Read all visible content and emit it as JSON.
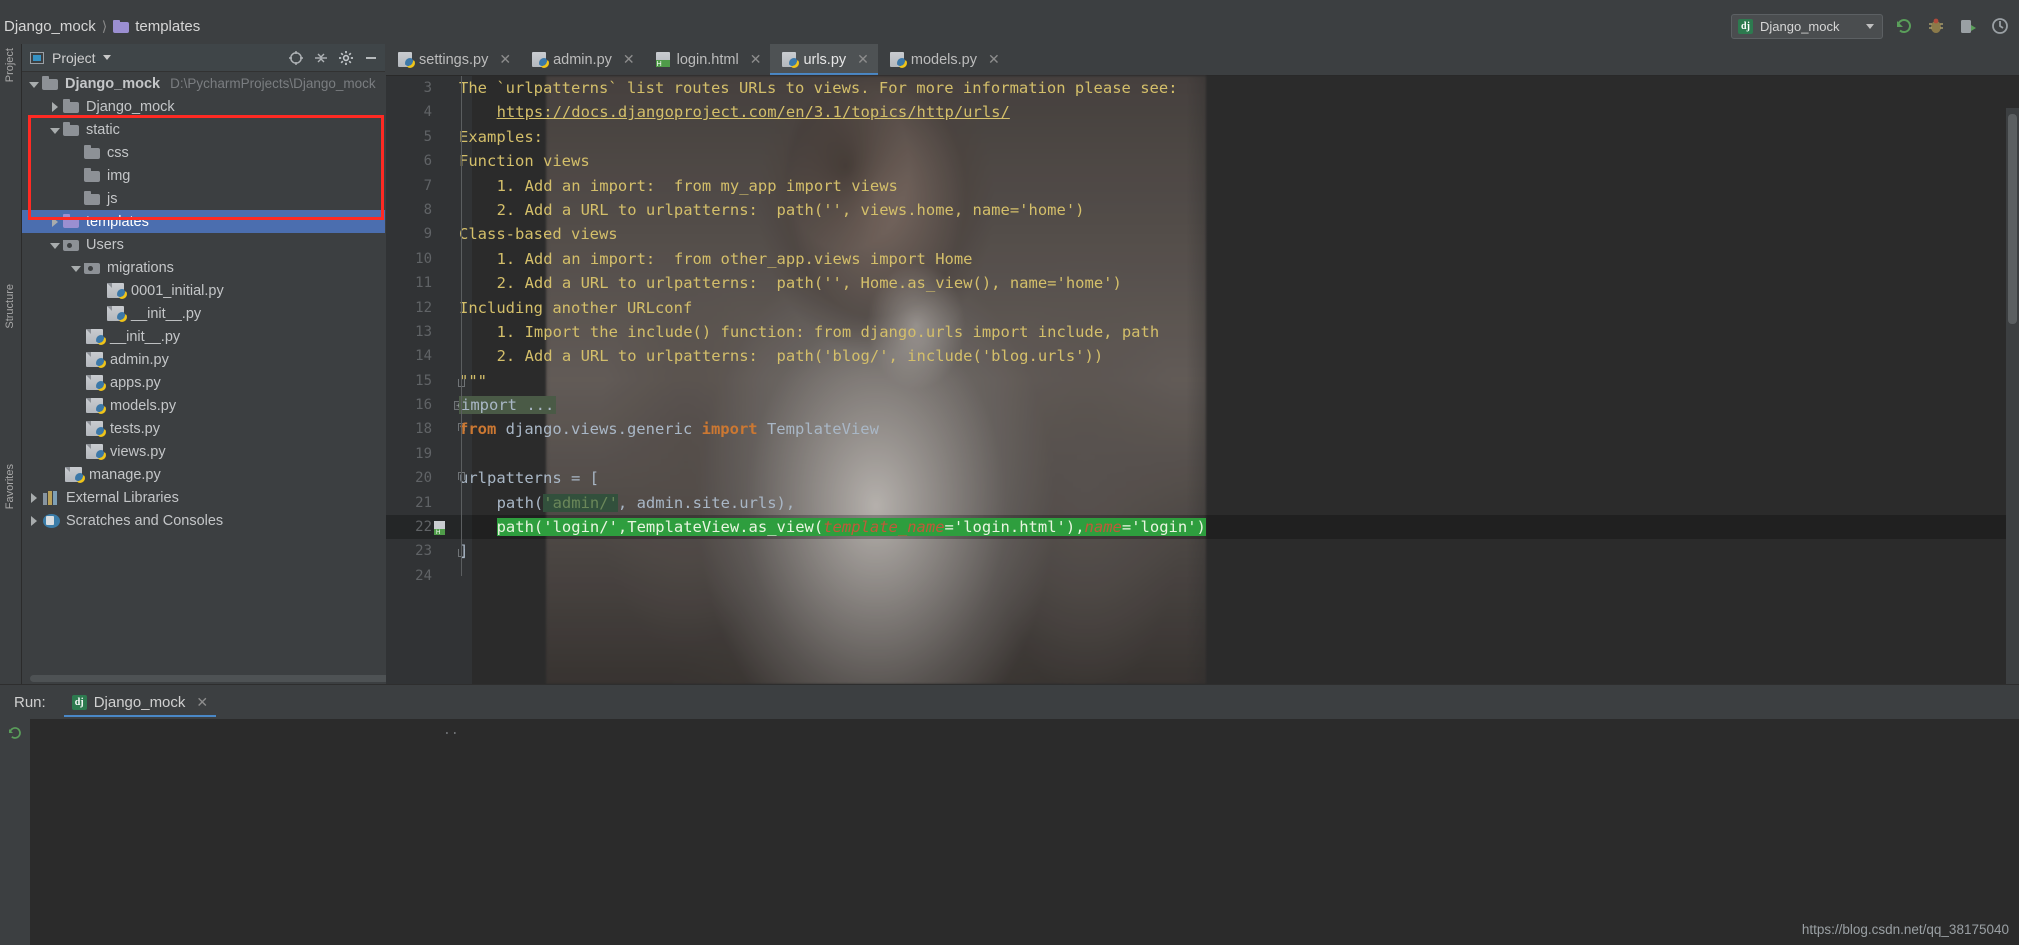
{
  "window": {
    "breadcrumb_project": "Django_mock",
    "breadcrumb_folder": "templates",
    "run_config_name": "Django_mock",
    "run_config_icon": "dj"
  },
  "toolbar_right": {
    "icons": [
      "rerun-icon",
      "debug-icon",
      "coverage-icon",
      "profile-icon"
    ]
  },
  "project_panel": {
    "title": "Project",
    "tools": [
      "locate-icon",
      "collapse-all-icon",
      "settings-gear-icon",
      "hide-icon"
    ],
    "tree": [
      {
        "label": "Django_mock",
        "path": "D:\\PycharmProjects\\Django_mock",
        "icon": "folder",
        "arrow": "down",
        "indent": 0,
        "bold": true,
        "selected": false
      },
      {
        "label": "Django_mock",
        "path": "",
        "icon": "folder",
        "arrow": "right",
        "indent": 1,
        "bold": false,
        "selected": false
      },
      {
        "label": "static",
        "path": "",
        "icon": "folder",
        "arrow": "down",
        "indent": 1,
        "bold": false,
        "selected": false
      },
      {
        "label": "css",
        "path": "",
        "icon": "folder",
        "arrow": "none",
        "indent": 2,
        "bold": false,
        "selected": false
      },
      {
        "label": "img",
        "path": "",
        "icon": "folder",
        "arrow": "none",
        "indent": 2,
        "bold": false,
        "selected": false
      },
      {
        "label": "js",
        "path": "",
        "icon": "folder",
        "arrow": "none",
        "indent": 2,
        "bold": false,
        "selected": false
      },
      {
        "label": "templates",
        "path": "",
        "icon": "folder-purple",
        "arrow": "right",
        "indent": 1,
        "bold": false,
        "selected": true
      },
      {
        "label": "Users",
        "path": "",
        "icon": "module",
        "arrow": "down",
        "indent": 1,
        "bold": false,
        "selected": false
      },
      {
        "label": "migrations",
        "path": "",
        "icon": "module",
        "arrow": "down",
        "indent": 2,
        "bold": false,
        "selected": false
      },
      {
        "label": "0001_initial.py",
        "path": "",
        "icon": "py",
        "arrow": "none",
        "indent": 3,
        "bold": false,
        "selected": false
      },
      {
        "label": "__init__.py",
        "path": "",
        "icon": "py",
        "arrow": "none",
        "indent": 3,
        "bold": false,
        "selected": false
      },
      {
        "label": "__init__.py",
        "path": "",
        "icon": "py",
        "arrow": "none",
        "indent": 2,
        "bold": false,
        "selected": false
      },
      {
        "label": "admin.py",
        "path": "",
        "icon": "py",
        "arrow": "none",
        "indent": 2,
        "bold": false,
        "selected": false
      },
      {
        "label": "apps.py",
        "path": "",
        "icon": "py",
        "arrow": "none",
        "indent": 2,
        "bold": false,
        "selected": false
      },
      {
        "label": "models.py",
        "path": "",
        "icon": "py",
        "arrow": "none",
        "indent": 2,
        "bold": false,
        "selected": false
      },
      {
        "label": "tests.py",
        "path": "",
        "icon": "py",
        "arrow": "none",
        "indent": 2,
        "bold": false,
        "selected": false
      },
      {
        "label": "views.py",
        "path": "",
        "icon": "py",
        "arrow": "none",
        "indent": 2,
        "bold": false,
        "selected": false
      },
      {
        "label": "manage.py",
        "path": "",
        "icon": "py",
        "arrow": "none",
        "indent": 1,
        "bold": false,
        "selected": false
      },
      {
        "label": "External Libraries",
        "path": "",
        "icon": "lib",
        "arrow": "right",
        "indent": 0,
        "bold": false,
        "selected": false
      },
      {
        "label": "Scratches and Consoles",
        "path": "",
        "icon": "scratch",
        "arrow": "right",
        "indent": 0,
        "bold": false,
        "selected": false
      }
    ]
  },
  "left_strip_labels": [
    "Project",
    "Structure",
    "Favorites"
  ],
  "editor": {
    "tabs": [
      {
        "label": "settings.py",
        "icon": "py",
        "active": false
      },
      {
        "label": "admin.py",
        "icon": "py",
        "active": false
      },
      {
        "label": "login.html",
        "icon": "html",
        "active": false
      },
      {
        "label": "urls.py",
        "icon": "py",
        "active": true
      },
      {
        "label": "models.py",
        "icon": "py",
        "active": false
      }
    ],
    "lines": [
      {
        "no": "3",
        "indent": 0,
        "kind": "doc",
        "text": "The `urlpatterns` list routes URLs to views. For more information please see:"
      },
      {
        "no": "4",
        "indent": 4,
        "kind": "link",
        "text": "https://docs.djangoproject.com/en/3.1/topics/http/urls/"
      },
      {
        "no": "5",
        "indent": 0,
        "kind": "doc",
        "text": "Examples:"
      },
      {
        "no": "6",
        "indent": 0,
        "kind": "doc",
        "text": "Function views"
      },
      {
        "no": "7",
        "indent": 4,
        "kind": "doc",
        "text": "1. Add an import:  from my_app import views"
      },
      {
        "no": "8",
        "indent": 4,
        "kind": "doc",
        "text": "2. Add a URL to urlpatterns:  path('', views.home, name='home')"
      },
      {
        "no": "9",
        "indent": 0,
        "kind": "doc",
        "text": "Class-based views"
      },
      {
        "no": "10",
        "indent": 4,
        "kind": "doc",
        "text": "1. Add an import:  from other_app.views import Home"
      },
      {
        "no": "11",
        "indent": 4,
        "kind": "doc",
        "text": "2. Add a URL to urlpatterns:  path('', Home.as_view(), name='home')"
      },
      {
        "no": "12",
        "indent": 0,
        "kind": "doc",
        "text": "Including another URLconf"
      },
      {
        "no": "13",
        "indent": 4,
        "kind": "doc",
        "text": "1. Import the include() function: from django.urls import include, path"
      },
      {
        "no": "14",
        "indent": 4,
        "kind": "doc",
        "text": "2. Add a URL to urlpatterns:  path('blog/', include('blog.urls'))"
      },
      {
        "no": "15",
        "indent": 0,
        "kind": "doc",
        "text": "\"\"\""
      },
      {
        "no": "16",
        "indent": 0,
        "kind": "fold",
        "text": "import ..."
      },
      {
        "no": "18",
        "indent": 0,
        "kind": "import_from",
        "text": "from django.views.generic import TemplateView"
      },
      {
        "no": "19",
        "indent": 0,
        "kind": "blank",
        "text": ""
      },
      {
        "no": "20",
        "indent": 0,
        "kind": "code",
        "text": "urlpatterns = ["
      },
      {
        "no": "21",
        "indent": 4,
        "kind": "code_path_admin",
        "text": "path('admin/', admin.site.urls),"
      },
      {
        "no": "22",
        "indent": 4,
        "kind": "selected",
        "text": "path('login/',TemplateView.as_view(template_name='login.html'),name='login')"
      },
      {
        "no": "23",
        "indent": 0,
        "kind": "code",
        "text": "]"
      },
      {
        "no": "24",
        "indent": 0,
        "kind": "blank",
        "text": ""
      }
    ],
    "line22_parts": {
      "head": "path('login/',TemplateView.as_view(",
      "kwarg1": "template_name",
      "eq1": "=",
      "val1": "'login.html'",
      "mid": "),",
      "kwarg2": "name",
      "eq2": "=",
      "val2": "'login')"
    },
    "line21_parts": {
      "pre": "path(",
      "occ": "'admin/'",
      "post": ", admin.site.urls),"
    },
    "line18_parts": {
      "kw1": "from",
      "mod": " django.views.generic ",
      "kw2": "import",
      "cls": " TemplateView"
    },
    "line20_parts": {
      "name": "urlpatterns",
      "op": " = ",
      "bracket": "["
    }
  },
  "run_panel": {
    "label": "Run:",
    "tab_label": "Django_mock",
    "tab_icon": "dj",
    "dots": ".."
  },
  "watermark": "https://blog.csdn.net/qq_38175040",
  "colors": {
    "accent_blue": "#4a88c7",
    "selection_green": "#2e9e3e",
    "annotation_red": "#ff2a23",
    "docstring_yellow": "#d4bf6a",
    "keyword_orange": "#cc7832",
    "string_green": "#6a8759",
    "tree_selected_blue": "#4b6eaf"
  }
}
